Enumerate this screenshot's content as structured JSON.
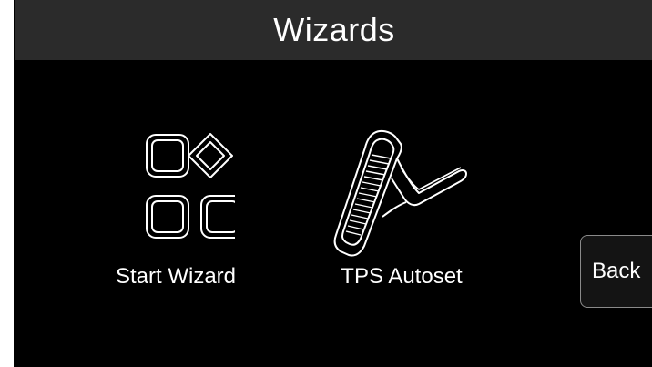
{
  "header": {
    "title": "Wizards"
  },
  "tiles": [
    {
      "label": "Start Wizard",
      "icon": "start-wizard-icon"
    },
    {
      "label": "TPS Autoset",
      "icon": "throttle-pedal-icon"
    }
  ],
  "back_button": {
    "label": "Back"
  },
  "colors": {
    "background": "#000000",
    "header_bg": "#2b2b2b",
    "text": "#ffffff",
    "button_border": "#8a8a8a"
  }
}
